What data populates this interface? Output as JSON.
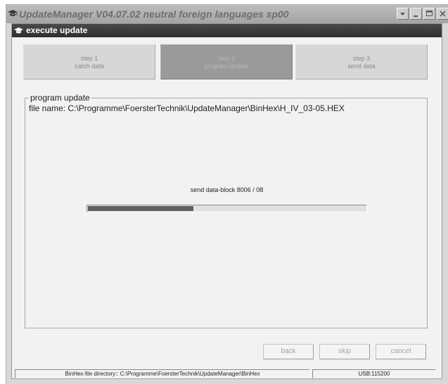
{
  "outer_window": {
    "title": "UpdateManager V04.07.02 neutral foreign languages sp00"
  },
  "dialog": {
    "title": "execute update"
  },
  "steps": [
    {
      "line1": "step 1",
      "line2": "catch data",
      "active": false
    },
    {
      "line1": "step 2",
      "line2": "program update",
      "active": true
    },
    {
      "line1": "step 3",
      "line2": "send data",
      "active": false
    }
  ],
  "group": {
    "legend": "program update",
    "file_name": "file name: C:\\Programme\\FoersterTechnik\\UpdateManager\\BinHex\\H_IV_03-05.HEX"
  },
  "progress": {
    "label": "send data-block 8006 / 08",
    "fraction": 0.38
  },
  "buttons": {
    "back": "back",
    "skip": "skip",
    "cancel": "cancel"
  },
  "statusbar": {
    "directory": "BinHex-file directory:: C:\\Programme\\FoersterTechnik\\UpdateManager\\BinHex",
    "port": "USB:115200"
  },
  "icons": {
    "app": "graduation-cap-icon",
    "minimize": "minimize-icon",
    "maximize": "maximize-icon",
    "close": "close-icon"
  }
}
